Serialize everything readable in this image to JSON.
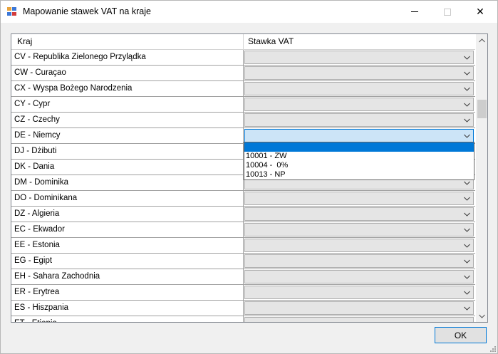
{
  "window": {
    "title": "Mapowanie stawek VAT na kraje",
    "minimize_glyph": "",
    "close_glyph": "✕"
  },
  "grid": {
    "columns": [
      "Kraj",
      "Stawka VAT"
    ],
    "rows": [
      {
        "kraj": "CV - Republika Zielonego Przylądka",
        "stawka": ""
      },
      {
        "kraj": "CW - Curaçao",
        "stawka": ""
      },
      {
        "kraj": "CX - Wyspa Bożego Narodzenia",
        "stawka": ""
      },
      {
        "kraj": "CY - Cypr",
        "stawka": ""
      },
      {
        "kraj": "CZ - Czechy",
        "stawka": ""
      },
      {
        "kraj": "DE - Niemcy",
        "stawka": "",
        "active": true
      },
      {
        "kraj": "DJ - Dżibuti",
        "stawka": ""
      },
      {
        "kraj": "DK - Dania",
        "stawka": ""
      },
      {
        "kraj": "DM - Dominika",
        "stawka": ""
      },
      {
        "kraj": "DO - Dominikana",
        "stawka": ""
      },
      {
        "kraj": "DZ - Algieria",
        "stawka": ""
      },
      {
        "kraj": "EC - Ekwador",
        "stawka": ""
      },
      {
        "kraj": "EE - Estonia",
        "stawka": ""
      },
      {
        "kraj": "EG - Egipt",
        "stawka": ""
      },
      {
        "kraj": "EH - Sahara Zachodnia",
        "stawka": ""
      },
      {
        "kraj": "ER - Erytrea",
        "stawka": ""
      },
      {
        "kraj": "ES - Hiszpania",
        "stawka": ""
      },
      {
        "kraj": "ET - Etiopia",
        "stawka": ""
      }
    ]
  },
  "dropdown": {
    "options": [
      "",
      "10001 - ZW",
      "10004 -  0%",
      "10013 - NP"
    ],
    "selected_index": 0
  },
  "buttons": {
    "ok_label": "OK"
  },
  "colors": {
    "accent": "#0078d7",
    "combo_bg": "#e5e5e5",
    "active_combo_bg": "#cce4f7"
  }
}
